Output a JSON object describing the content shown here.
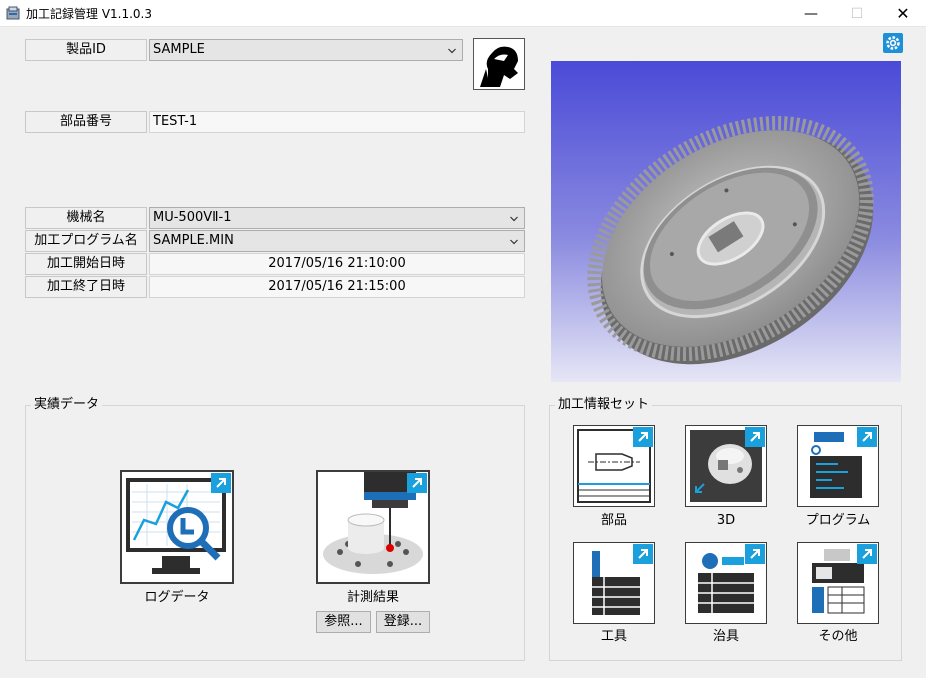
{
  "window": {
    "title": "加工記録管理 V1.1.0.3",
    "minimize_glyph": "—",
    "maximize_glyph": "☐",
    "close_glyph": "✕"
  },
  "product": {
    "id_label": "製品ID",
    "id_value": "SAMPLE",
    "part_no_label": "部品番号",
    "part_no_value": "TEST-1"
  },
  "machine": {
    "machine_label": "機械名",
    "machine_value": "MU-500VⅡ-1",
    "program_label": "加工プログラム名",
    "program_value": "SAMPLE.MIN",
    "start_label": "加工開始日時",
    "start_value": "2017/05/16 21:10:00",
    "end_label": "加工終了日時",
    "end_value": "2017/05/16 21:15:00"
  },
  "results": {
    "title": "実績データ",
    "log_label": "ログデータ",
    "measure_label": "計測結果",
    "ref_button": "参照...",
    "register_button": "登録..."
  },
  "info_set": {
    "title": "加工情報セット",
    "items": [
      {
        "label": "部品",
        "icon": "part-drawing-icon"
      },
      {
        "label": "3D",
        "icon": "3d-model-icon"
      },
      {
        "label": "プログラム",
        "icon": "program-icon"
      },
      {
        "label": "工具",
        "icon": "tool-icon"
      },
      {
        "label": "治具",
        "icon": "fixture-icon"
      },
      {
        "label": "その他",
        "icon": "other-icon"
      }
    ]
  },
  "colors": {
    "accent": "#1aa0dc",
    "viewer_top": "#4a4ad8",
    "viewer_bottom": "#e6e6f6"
  }
}
